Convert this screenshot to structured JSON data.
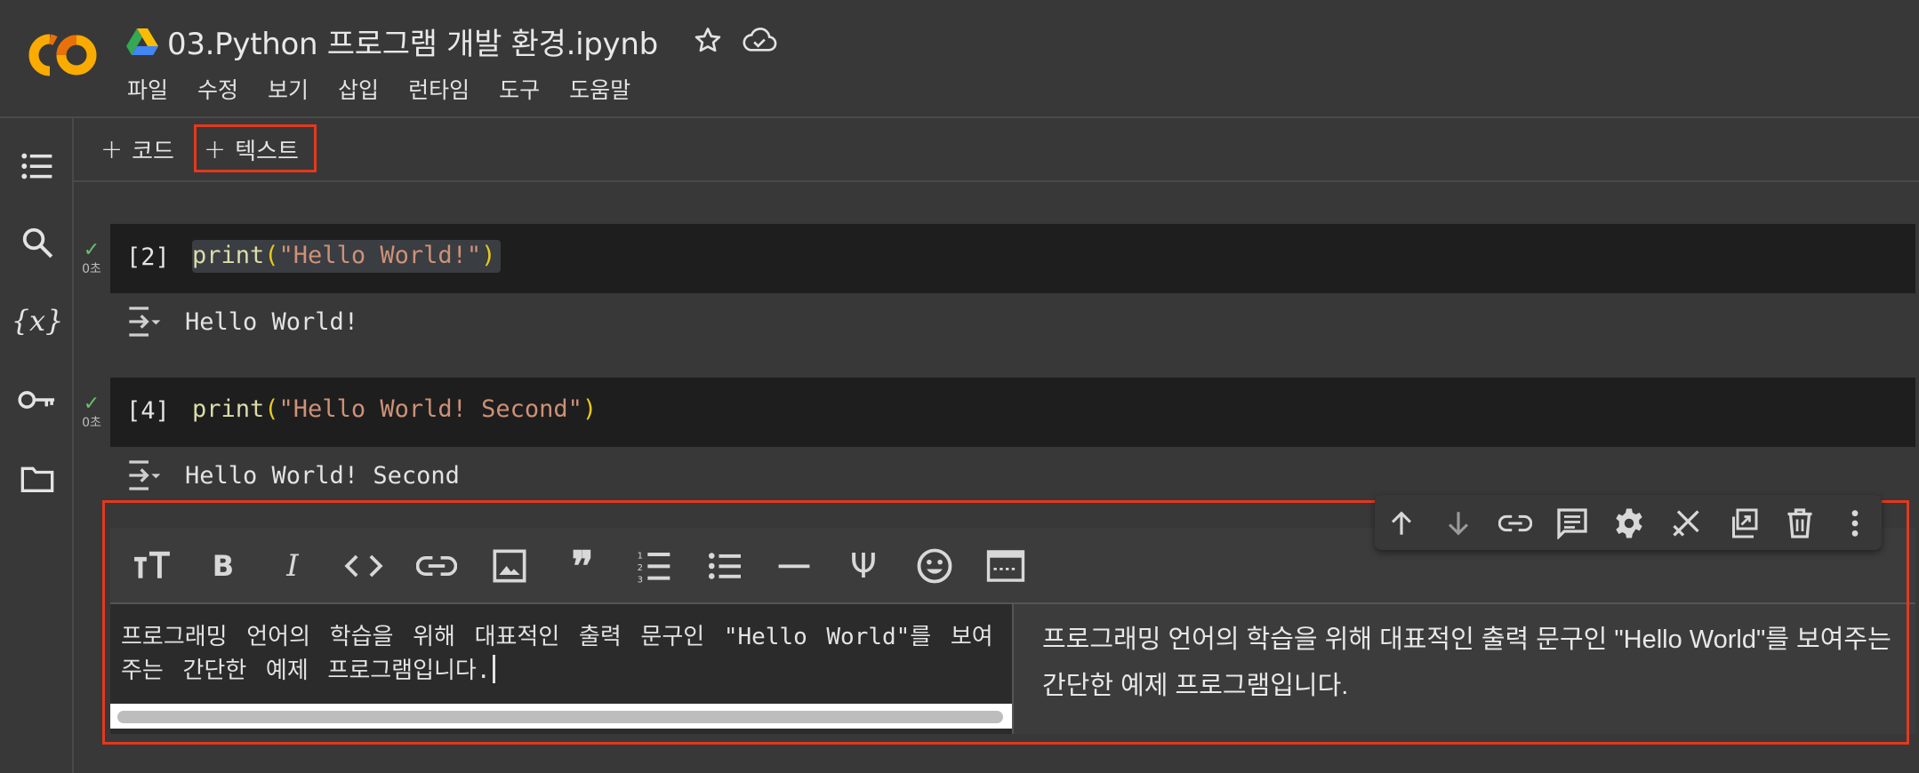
{
  "app": {
    "logo_text": "CO",
    "document_title": "03.Python 프로그램 개발 환경.ipynb"
  },
  "menu": {
    "items": [
      {
        "label": "파일"
      },
      {
        "label": "수정"
      },
      {
        "label": "보기"
      },
      {
        "label": "삽입"
      },
      {
        "label": "런타임"
      },
      {
        "label": "도구"
      },
      {
        "label": "도움말"
      }
    ]
  },
  "sidebar": {
    "icons": [
      "table-of-contents-icon",
      "search-icon",
      "variables-icon",
      "secrets-key-icon",
      "files-folder-icon"
    ],
    "variables_label": "{x}"
  },
  "toolbar": {
    "add_code_label": "코드",
    "add_text_label": "텍스트",
    "plus_glyph": "+"
  },
  "cells": [
    {
      "execution_count": "[2]",
      "status_time": "0초",
      "code": {
        "fn": "print",
        "open": "(",
        "string": "\"Hello World!\"",
        "close": ")"
      },
      "output": "Hello World!"
    },
    {
      "execution_count": "[4]",
      "status_time": "0초",
      "code": {
        "fn": "print",
        "open": "(",
        "string": "\"Hello World! Second\"",
        "close": ")"
      },
      "output": "Hello World! Second"
    }
  ],
  "text_cell": {
    "format_buttons": [
      "heading",
      "bold",
      "italic",
      "code",
      "link",
      "image",
      "quote",
      "numbered-list",
      "bulleted-list",
      "horizontal-rule",
      "latex-psi",
      "emoji",
      "mermaid-chart"
    ],
    "source": "프로그래밍 언어의 학습을 위해 대표적인 출력 문구인 \"Hello World\"를 보여주는 간단한 예제 프로그램입니다.",
    "preview": "프로그래밍 언어의 학습을 위해 대표적인 출력 문구인 \"Hello World\"를 보여주는 간단한 예제 프로그램입니다."
  },
  "cell_actions": [
    "move-up",
    "move-down",
    "link",
    "comment",
    "settings",
    "disconnect",
    "mirror",
    "delete",
    "more"
  ],
  "colors": {
    "background": "#383838",
    "code_cell_bg": "#1e1e1e",
    "highlight_red": "#e2391e",
    "logo_orange": "#f9ab00",
    "string": "#ce9178",
    "function": "#dcdcaa"
  }
}
